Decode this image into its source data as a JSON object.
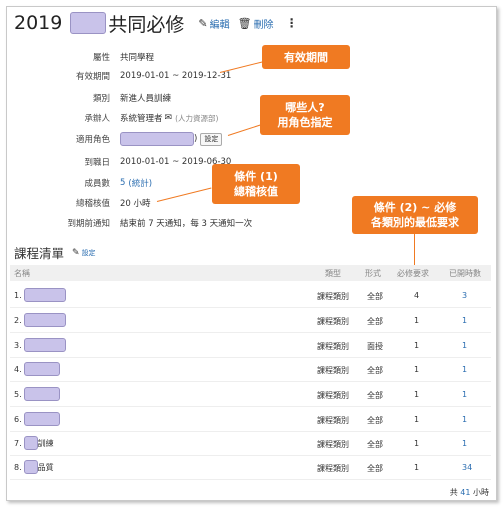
{
  "header": {
    "year": "2019",
    "title": "共同必修",
    "edit_label": "編輯",
    "delete_label": "刪除",
    "more_label": "⋮"
  },
  "info": {
    "attribute_label": "屬性",
    "attribute_value": "共同學程",
    "validity_label": "有效期間",
    "validity_value": "2019-01-01 ~ 2019-12-31",
    "category_label": "類別",
    "category_value": "新進人員訓練",
    "handler_label": "承辦人",
    "handler_value": "系統管理者",
    "handler_dept": "(人力資源部)",
    "roles_label": "適用角色",
    "roles_suffix": ")",
    "roles_button": "設定",
    "arrival_label": "到職日",
    "arrival_value": "2010-01-01 ~ 2019-06-30",
    "members_label": "成員數",
    "members_count": "5",
    "members_stats": "(統計)",
    "total_hours_label": "總稽核值",
    "total_hours_value": "20 小時",
    "notice_label": "到期前通知",
    "notice_value": "結束前 7 天通知，每 3 天通知一次"
  },
  "callouts": {
    "validity": "有效期間",
    "roles_line1": "哪些人?",
    "roles_line2": "用角色指定",
    "cond1_line1": "條件 (1)",
    "cond1_line2": "總稽核值",
    "cond2_line1": "條件 (2) ~ 必修",
    "cond2_line2": "各類別的最低要求",
    "color": "#f07a22"
  },
  "course_list": {
    "heading": "課程清單",
    "settings_label": "設定",
    "columns": [
      "名稱",
      "類型",
      "形式",
      "必修要求",
      "已開時數"
    ],
    "rows": [
      {
        "idx": "1.",
        "suffix": "",
        "type": "課程類別",
        "form": "全部",
        "req": "4",
        "hours": "3"
      },
      {
        "idx": "2.",
        "suffix": "",
        "type": "課程類別",
        "form": "全部",
        "req": "1",
        "hours": "1"
      },
      {
        "idx": "3.",
        "suffix": "",
        "type": "課程類別",
        "form": "面授",
        "req": "1",
        "hours": "1"
      },
      {
        "idx": "4.",
        "suffix": "",
        "type": "課程類別",
        "form": "全部",
        "req": "1",
        "hours": "1"
      },
      {
        "idx": "5.",
        "suffix": "",
        "type": "課程類別",
        "form": "全部",
        "req": "1",
        "hours": "1"
      },
      {
        "idx": "6.",
        "suffix": "",
        "type": "課程類別",
        "form": "全部",
        "req": "1",
        "hours": "1"
      },
      {
        "idx": "7.",
        "suffix": "訓練",
        "type": "課程類別",
        "form": "全部",
        "req": "1",
        "hours": "1"
      },
      {
        "idx": "8.",
        "suffix": "品質",
        "type": "課程類別",
        "form": "全部",
        "req": "1",
        "hours": "34"
      }
    ],
    "total_prefix": "共",
    "total_value": "41",
    "total_suffix": "小時"
  }
}
